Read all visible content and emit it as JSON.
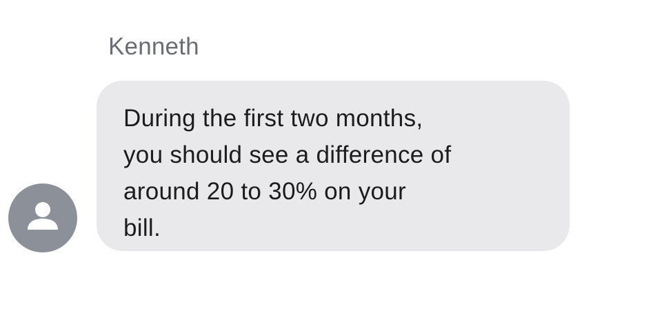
{
  "conversation": {
    "message": {
      "sender": "Kenneth",
      "text": "During the first two months,\nyou should see a difference of\naround 20 to 30% on your\nbill.",
      "avatar_icon": "person-silhouette-icon"
    }
  },
  "colors": {
    "bubble_background": "#e9e9eb",
    "avatar_background": "#8b9099",
    "sender_name": "#6a6d73",
    "message_text": "#1c1c1e"
  }
}
